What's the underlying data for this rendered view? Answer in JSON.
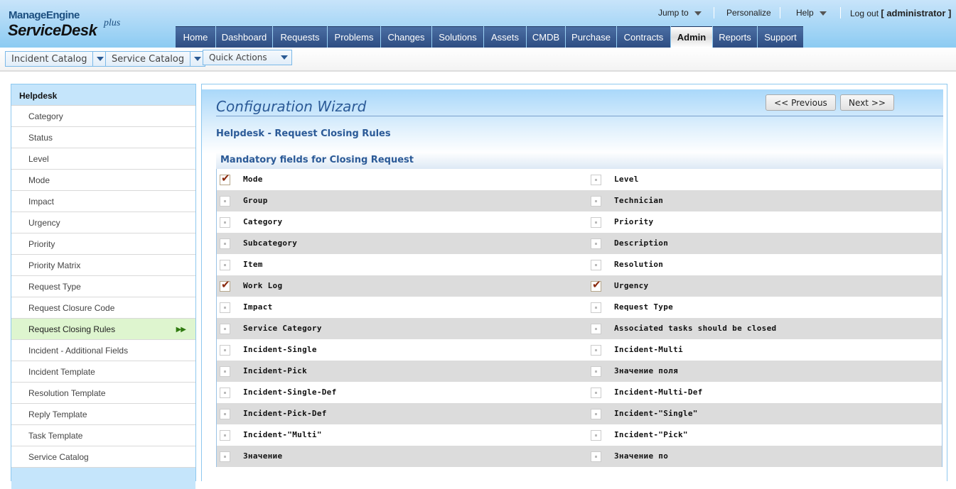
{
  "header": {
    "logo_top": "ManageEngine",
    "logo_main": "ServiceDesk",
    "logo_plus": "plus",
    "jump_to": "Jump to",
    "personalize": "Personalize",
    "help": "Help",
    "logout": "Log out",
    "user": "[ administrator ]"
  },
  "nav": [
    "Home",
    "Dashboard",
    "Requests",
    "Problems",
    "Changes",
    "Solutions",
    "Assets",
    "CMDB",
    "Purchase",
    "Contracts",
    "Admin",
    "Reports",
    "Support"
  ],
  "nav_active": "Admin",
  "toolbar": {
    "incident_catalog": "Incident Catalog",
    "service_catalog": "Service Catalog",
    "quick_actions": "Quick Actions"
  },
  "sidebar": {
    "header": "Helpdesk",
    "items": [
      "Category",
      "Status",
      "Level",
      "Mode",
      "Impact",
      "Urgency",
      "Priority",
      "Priority Matrix",
      "Request Type",
      "Request Closure Code",
      "Request Closing Rules",
      "Incident - Additional Fields",
      "Incident Template",
      "Resolution Template",
      "Reply Template",
      "Task Template",
      "Service Catalog"
    ],
    "selected": "Request Closing Rules"
  },
  "wizard": {
    "title": "Configuration Wizard",
    "subtitle": "Helpdesk - Request Closing Rules",
    "previous": "<< Previous",
    "next": "Next >>",
    "section": "Mandatory fields for Closing Request"
  },
  "fields": [
    [
      {
        "label": "Mode",
        "checked": true
      },
      {
        "label": "Level",
        "checked": false
      }
    ],
    [
      {
        "label": "Group",
        "checked": false
      },
      {
        "label": "Technician",
        "checked": false
      }
    ],
    [
      {
        "label": "Category",
        "checked": false
      },
      {
        "label": "Priority",
        "checked": false
      }
    ],
    [
      {
        "label": "Subcategory",
        "checked": false
      },
      {
        "label": "Description",
        "checked": false
      }
    ],
    [
      {
        "label": "Item",
        "checked": false
      },
      {
        "label": "Resolution",
        "checked": false
      }
    ],
    [
      {
        "label": "Work Log",
        "checked": true
      },
      {
        "label": "Urgency",
        "checked": true
      }
    ],
    [
      {
        "label": "Impact",
        "checked": false
      },
      {
        "label": "Request Type",
        "checked": false
      }
    ],
    [
      {
        "label": "Service Category",
        "checked": false
      },
      {
        "label": "Associated tasks should be closed",
        "checked": false
      }
    ],
    [
      {
        "label": "Incident-Single",
        "checked": false
      },
      {
        "label": "Incident-Multi",
        "checked": false
      }
    ],
    [
      {
        "label": "Incident-Pick",
        "checked": false
      },
      {
        "label": "Значение поля",
        "checked": false
      }
    ],
    [
      {
        "label": "Incident-Single-Def",
        "checked": false
      },
      {
        "label": "Incident-Multi-Def",
        "checked": false
      }
    ],
    [
      {
        "label": "Incident-Pick-Def",
        "checked": false
      },
      {
        "label": "Incident-\"Single\"",
        "checked": false
      }
    ],
    [
      {
        "label": "Incident-\"Multi\"",
        "checked": false
      },
      {
        "label": "Incident-\"Pick\"",
        "checked": false
      }
    ],
    [
      {
        "label": "Значение",
        "checked": false
      },
      {
        "label": "Значение по",
        "checked": false
      }
    ]
  ]
}
